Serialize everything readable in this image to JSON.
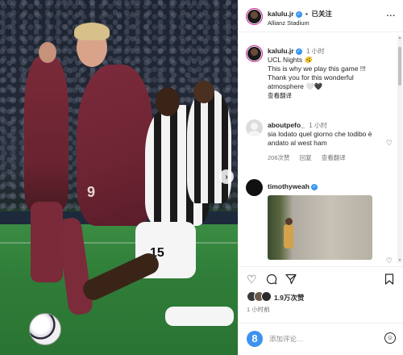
{
  "post": {
    "author": "kalulu.jr",
    "verified_icon": "verified-badge-icon",
    "follow_label": "已关注",
    "location": "Allianz Stadium",
    "more_label": "..."
  },
  "photo": {
    "jersey_numbers": [
      "9",
      "15"
    ],
    "next_arrow": "›"
  },
  "caption": {
    "author": "kalulu.jr",
    "time": "1 小时",
    "lines": [
      "UCL Nights 🫨",
      "This is why we play this game !!!",
      "Thank you for this wonderful",
      "atmosphere 🤍🖤"
    ],
    "translate_label": "查看翻译"
  },
  "comments": [
    {
      "author": "aboutpefo_",
      "time": "1 小时",
      "text": "sia lodato quel giorno che todibo è andato al west ham",
      "likes": "206次赞",
      "reply_label": "回复",
      "translate_label": "查看翻译"
    },
    {
      "author": "timothyweah",
      "verified": true
    }
  ],
  "stats": {
    "likes": "1.9万次赞",
    "time_ago": "1 小时前"
  },
  "add_comment": {
    "placeholder": "添加评论…"
  },
  "colors": {
    "verified_blue": "#3897f0",
    "text": "#262626",
    "muted": "#737373",
    "emoji_button": "#3e92f0"
  }
}
